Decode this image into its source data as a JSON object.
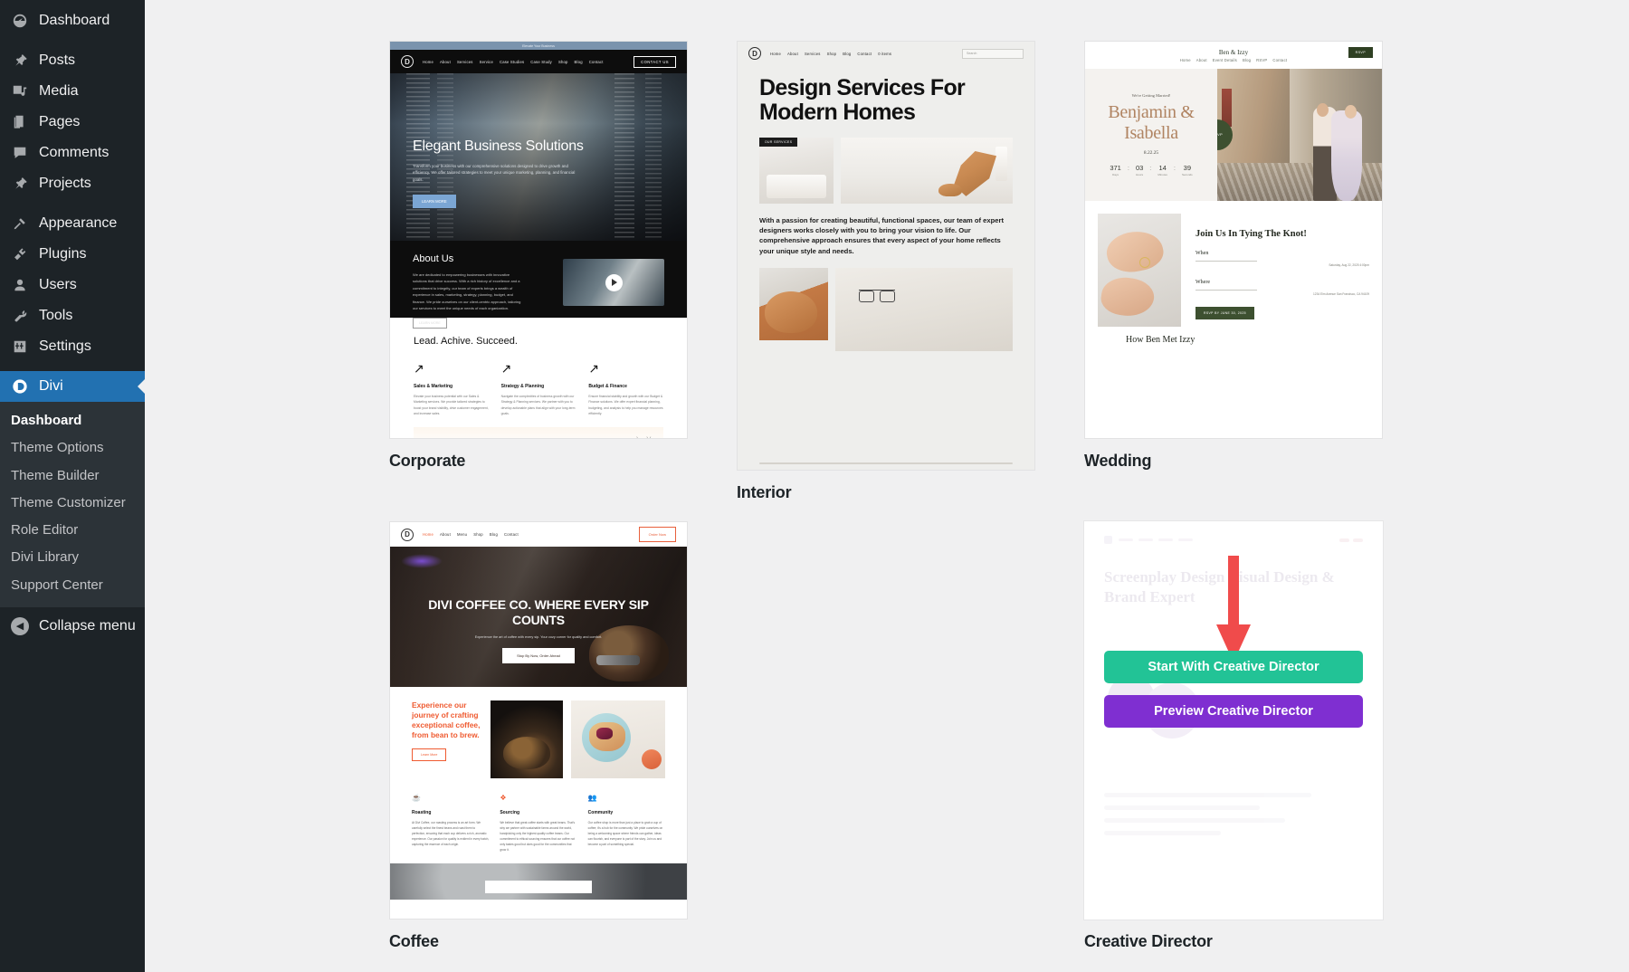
{
  "sidebar": {
    "items": [
      {
        "label": "Dashboard",
        "icon": "dashboard-icon",
        "name": "sidebar-item-dashboard"
      },
      {
        "label": "Posts",
        "icon": "pin-icon",
        "name": "sidebar-item-posts"
      },
      {
        "label": "Media",
        "icon": "media-icon",
        "name": "sidebar-item-media"
      },
      {
        "label": "Pages",
        "icon": "pages-icon",
        "name": "sidebar-item-pages"
      },
      {
        "label": "Comments",
        "icon": "comment-icon",
        "name": "sidebar-item-comments"
      },
      {
        "label": "Projects",
        "icon": "pin-icon",
        "name": "sidebar-item-projects"
      },
      {
        "label": "Appearance",
        "icon": "brush-icon",
        "name": "sidebar-item-appearance"
      },
      {
        "label": "Plugins",
        "icon": "plug-icon",
        "name": "sidebar-item-plugins"
      },
      {
        "label": "Users",
        "icon": "user-icon",
        "name": "sidebar-item-users"
      },
      {
        "label": "Tools",
        "icon": "wrench-icon",
        "name": "sidebar-item-tools"
      },
      {
        "label": "Settings",
        "icon": "settings-icon",
        "name": "sidebar-item-settings"
      }
    ],
    "current": {
      "label": "Divi",
      "icon": "divi-logo-icon"
    },
    "submenu": [
      {
        "label": "Dashboard",
        "active": true
      },
      {
        "label": "Theme Options",
        "active": false
      },
      {
        "label": "Theme Builder",
        "active": false
      },
      {
        "label": "Theme Customizer",
        "active": false
      },
      {
        "label": "Role Editor",
        "active": false
      },
      {
        "label": "Divi Library",
        "active": false
      },
      {
        "label": "Support Center",
        "active": false
      }
    ],
    "collapse_label": "Collapse menu",
    "accent_color": "#2271b1",
    "background_color": "#1d2327"
  },
  "cards": {
    "corporate": {
      "title": "Corporate",
      "topbar": "Elevate Your Business",
      "nav": [
        "Home",
        "About",
        "Services",
        "Service",
        "Case Studies",
        "Case Study",
        "Shop",
        "Blog",
        "Contact"
      ],
      "cta": "CONTACT US",
      "hero_title": "Elegant Business Solutions",
      "hero_text": "Transform your business with our comprehensive solutions designed to drive growth and efficiency. We offer tailored strategies to meet your unique marketing, planning, and financial goals.",
      "hero_button": "LEARN MORE",
      "about_title": "About Us",
      "about_text": "We are dedicated to empowering businesses with innovative solutions that drive success. With a rich history of excellence and a commitment to integrity, our team of experts brings a wealth of experience in sales, marketing, strategy, planning, budget, and finance. We pride ourselves on our client-centric approach, tailoring our services to meet the unique needs of each organization.",
      "about_button": "LEARN MORE",
      "feature_title": "Lead. Achive. Succeed.",
      "features": [
        {
          "title": "Sales & Marketing",
          "text": "Elevate your business potential with our Sales & Marketing services. We provide tailored strategies to boost your brand visibility, drive customer engagement, and increase sales."
        },
        {
          "title": "Strategy & Planning",
          "text": "Navigate the complexities of business growth with our Strategy & Planning services. We partner with you to develop actionable plans that align with your long-term goals."
        },
        {
          "title": "Budget & Finance",
          "text": "Ensure financial stability and growth with our Budget & Finance solutions. We offer expert financial planning, budgeting, and analysis to help you manage resources efficiently."
        }
      ]
    },
    "interior": {
      "title": "Interior",
      "nav": [
        "Home",
        "About",
        "Services",
        "Shop",
        "Blog",
        "Contact",
        "0 items"
      ],
      "search_placeholder": "Search",
      "headline": "Design Services For Modern Homes",
      "badge": "OUR SERVICES",
      "body": "With a passion for creating beautiful, functional spaces, our team of expert designers works closely with you to bring your vision to life. Our comprehensive approach ensures that every aspect of your home reflects your unique style and needs."
    },
    "wedding": {
      "title": "Wedding",
      "brand": "Ben & Izzy",
      "nav": [
        "Home",
        "About",
        "Event Details",
        "Blog",
        "RSVP",
        "Contact"
      ],
      "rsvp_top": "RSVP",
      "eyebrow": "We're Getting Married!",
      "names": "Benjamin & Isabella",
      "date": "8.22.25",
      "countdown": [
        {
          "value": "371",
          "label": "Days"
        },
        {
          "value": "03",
          "label": "Hours"
        },
        {
          "value": "14",
          "label": "Minutes"
        },
        {
          "value": "39",
          "label": "Seconds"
        }
      ],
      "rsvp_circle": "RSVP",
      "knot_title": "Join Us In Tying The Knot!",
      "when_label": "When",
      "when_value": "Saturday, Aug 22, 2025\n4:00pm",
      "where_label": "Where",
      "where_value": "1234 Elm Avenue\nSan Francisco, CA 94109",
      "knot_button": "RSVP BY JUNE 30, 2025",
      "met_title": "How Ben Met Izzy"
    },
    "coffee": {
      "title": "Coffee",
      "nav": [
        "Home",
        "About",
        "Menu",
        "Shop",
        "Blog",
        "Contact"
      ],
      "cta": "Order Now",
      "hero_title": "DIVI COFFEE CO. WHERE EVERY SIP COUNTS",
      "hero_text": "Experience the art of coffee with every sip. Your cozy corner for quality and comfort.",
      "hero_button": "Stop By Now, Order Ahead",
      "mid_title": "Experience our journey of crafting exceptional coffee, from bean to brew.",
      "mid_button": "Learn More",
      "features": [
        {
          "icon": "coffee-cup-icon",
          "title": "Roasting",
          "text": "At Divi Coffee, our roasting process is an art form. We carefully select the finest beans and roast them to perfection, ensuring that each cup delivers a rich, aromatic experience. Our passion for quality is evident in every batch, capturing the essence of each origin."
        },
        {
          "icon": "leaf-icon",
          "title": "Sourcing",
          "text": "We believe that great coffee starts with great beans. That's why we partner with sustainable farms around the world, handpicking only the highest quality coffee beans. Our commitment to ethical sourcing ensures that our coffee not only tastes good but does good for the communities that grow it."
        },
        {
          "icon": "community-icon",
          "title": "Community",
          "text": "Our coffee shop is more than just a place to grab a cup of coffee; it's a hub for the community. We pride ourselves on being a welcoming space where friends can gather, ideas can flourish, and everyone is part of the story. Join us and become a part of something special."
        }
      ]
    },
    "creative_director": {
      "title": "Creative Director",
      "ghost_heading": "Screenplay Design\nVisual Design & Brand\nExpert",
      "start_button": "Start With Creative Director",
      "preview_button": "Preview Creative Director",
      "start_button_color": "#22c396",
      "preview_button_color": "#7f2fd1",
      "arrow_color": "#f04b4b"
    }
  }
}
